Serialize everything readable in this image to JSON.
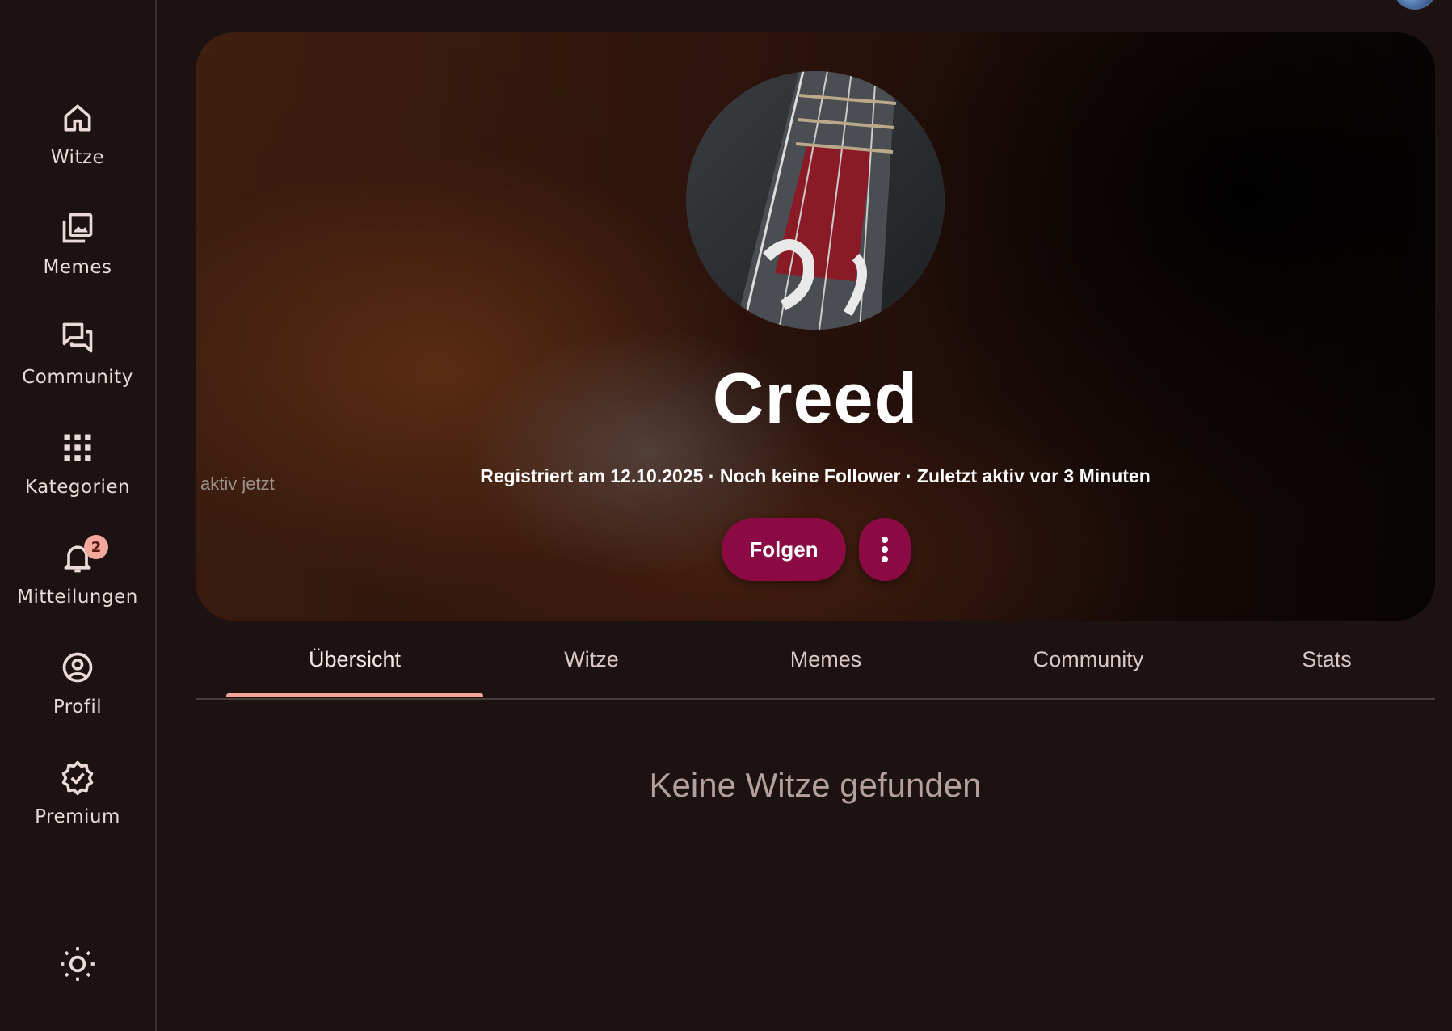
{
  "sidebar": {
    "items": [
      {
        "label": "Witze",
        "icon": "home-icon"
      },
      {
        "label": "Memes",
        "icon": "image-library-icon"
      },
      {
        "label": "Community",
        "icon": "forum-icon"
      },
      {
        "label": "Kategorien",
        "icon": "apps-grid-icon"
      },
      {
        "label": "Mitteilungen",
        "icon": "bell-icon",
        "badge": "2"
      },
      {
        "label": "Profil",
        "icon": "account-circle-icon"
      },
      {
        "label": "Premium",
        "icon": "verified-badge-icon"
      }
    ],
    "theme_toggle_icon": "sun-icon"
  },
  "profile": {
    "name": "Creed",
    "meta": "Registriert am 12.10.2025 · Noch keine Follower · Zuletzt aktiv vor 3 Minuten",
    "banner_overlay_text": "aktiv jetzt",
    "follow_label": "Folgen",
    "more_icon": "more-vert-icon"
  },
  "tabs": [
    {
      "label": "Übersicht",
      "active": true
    },
    {
      "label": "Witze",
      "active": false
    },
    {
      "label": "Memes",
      "active": false
    },
    {
      "label": "Community",
      "active": false
    },
    {
      "label": "Stats",
      "active": false
    }
  ],
  "content": {
    "empty_message": "Keine Witze gefunden"
  },
  "colors": {
    "background": "#1b1211",
    "accent_button": "#8b0a44",
    "tab_indicator": "#f2a596",
    "badge": "#f5a99c"
  }
}
